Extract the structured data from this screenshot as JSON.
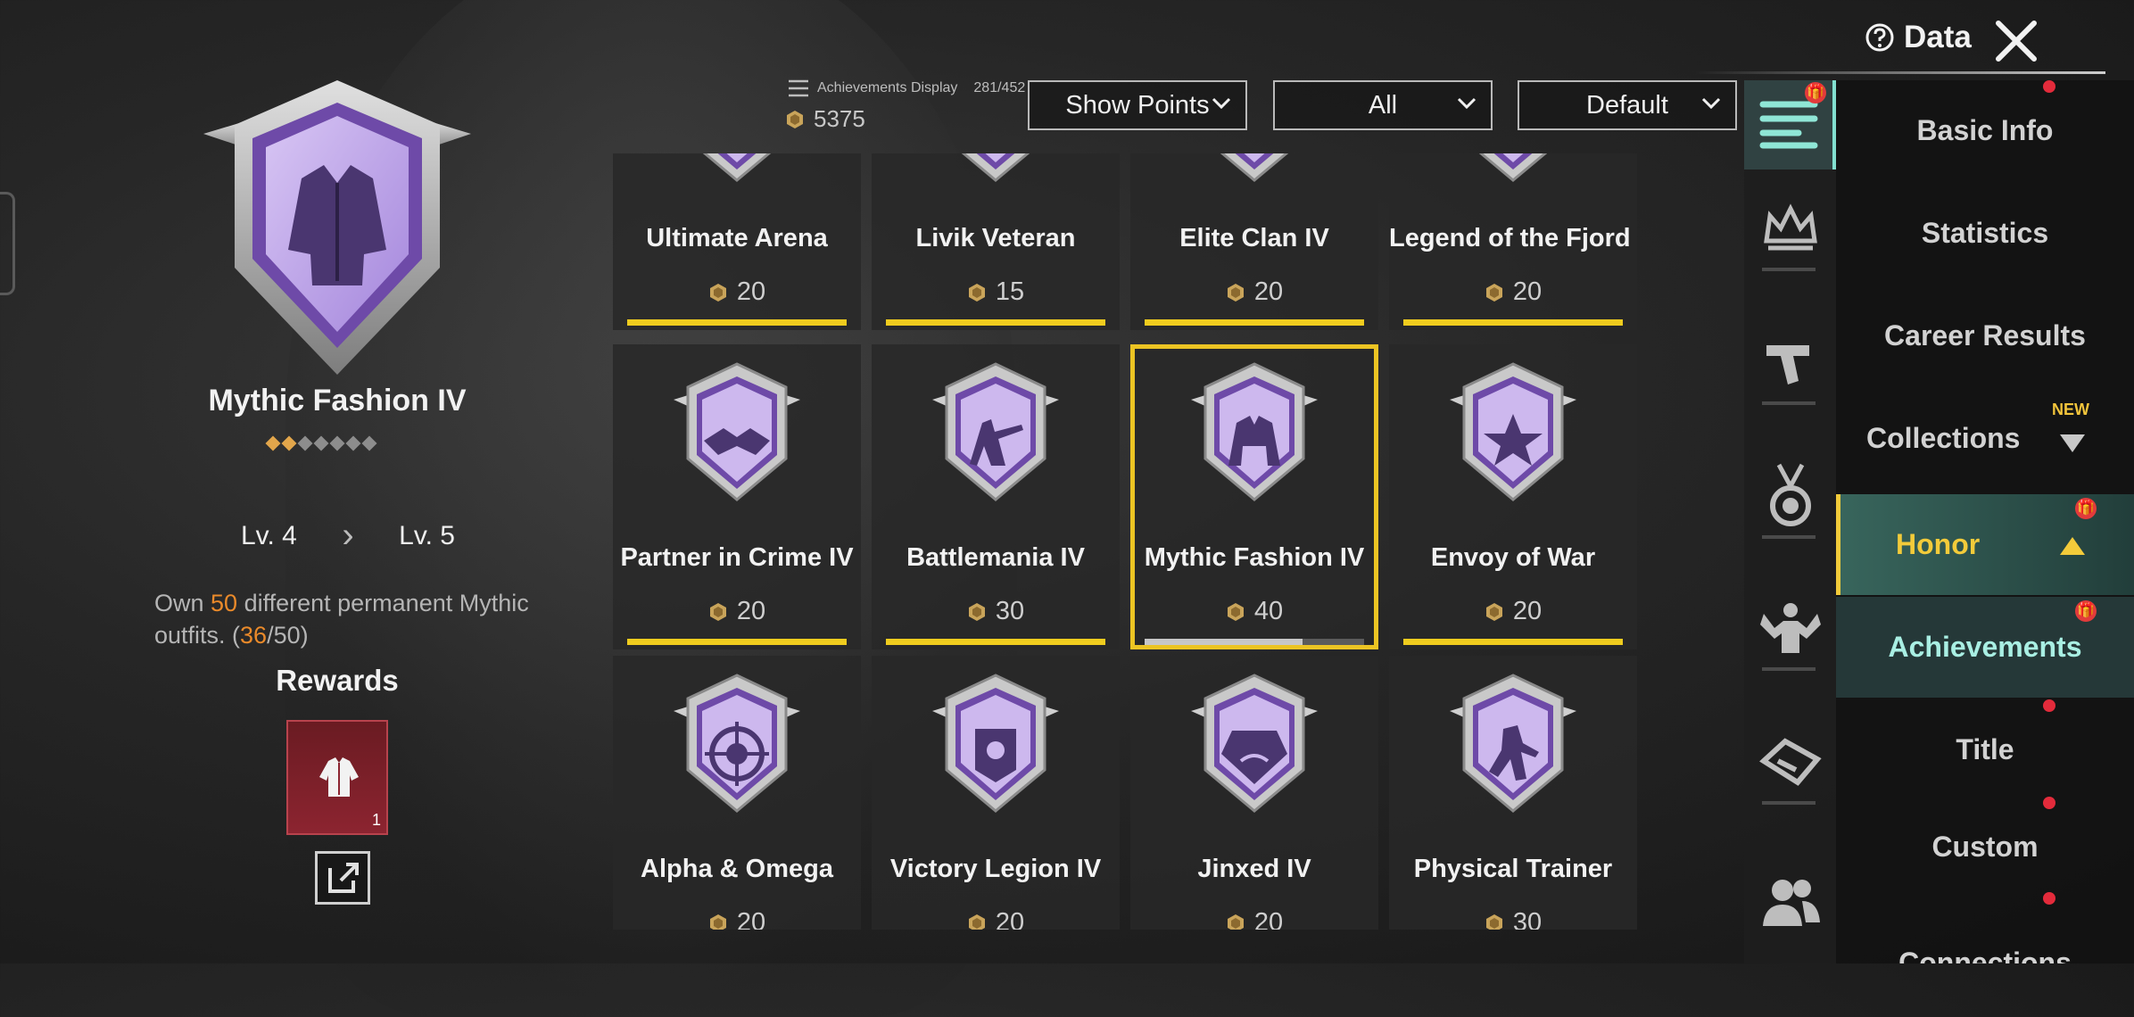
{
  "top": {
    "data_label": "Data"
  },
  "header": {
    "display_label": "Achievements Display",
    "display_count": "281/452",
    "points_total": "5375",
    "dropdowns": [
      {
        "label": "Show Points"
      },
      {
        "label": "All"
      },
      {
        "label": "Default"
      }
    ]
  },
  "detail": {
    "name": "Mythic Fashion IV",
    "stars_filled": 2,
    "stars_total": 7,
    "level_from": "Lv. 4",
    "level_to": "Lv. 5",
    "desc_pre": "Own ",
    "desc_num": "50",
    "desc_mid": " different permanent Mythic outfits. (",
    "desc_progress": "36",
    "desc_post": "/50)",
    "rewards_title": "Rewards",
    "reward_count": "1"
  },
  "achievements": [
    {
      "name": "Ultimate Arena",
      "points": "20",
      "progress": 1.0
    },
    {
      "name": "Livik Veteran",
      "points": "15",
      "progress": 1.0
    },
    {
      "name": "Elite Clan IV",
      "points": "20",
      "progress": 1.0
    },
    {
      "name": "Legend of the Fjord IV",
      "points": "20",
      "progress": 1.0
    },
    {
      "name": "Partner in Crime IV",
      "points": "20",
      "progress": 1.0
    },
    {
      "name": "Battlemania IV",
      "points": "30",
      "progress": 1.0
    },
    {
      "name": "Mythic Fashion IV",
      "points": "40",
      "progress": 0.72
    },
    {
      "name": "Envoy of War",
      "points": "20",
      "progress": 1.0
    },
    {
      "name": "Alpha & Omega",
      "points": "20",
      "progress": 1.0
    },
    {
      "name": "Victory Legion IV",
      "points": "20",
      "progress": 1.0
    },
    {
      "name": "Jinxed IV",
      "points": "20",
      "progress": 1.0
    },
    {
      "name": "Physical Trainer",
      "points": "30",
      "progress": 1.0
    }
  ],
  "menu": {
    "basic_info": "Basic Info",
    "statistics": "Statistics",
    "career_results": "Career Results",
    "collections": "Collections",
    "new_tag": "NEW",
    "honor": "Honor",
    "achievements": "Achievements",
    "title": "Title",
    "custom": "Custom",
    "connections": "Connections"
  },
  "colors": {
    "accent_gold": "#f0cc1e",
    "accent_teal": "#82e0d0",
    "badge_purple": "#a57ce0",
    "alert_red": "#e32b3b"
  }
}
